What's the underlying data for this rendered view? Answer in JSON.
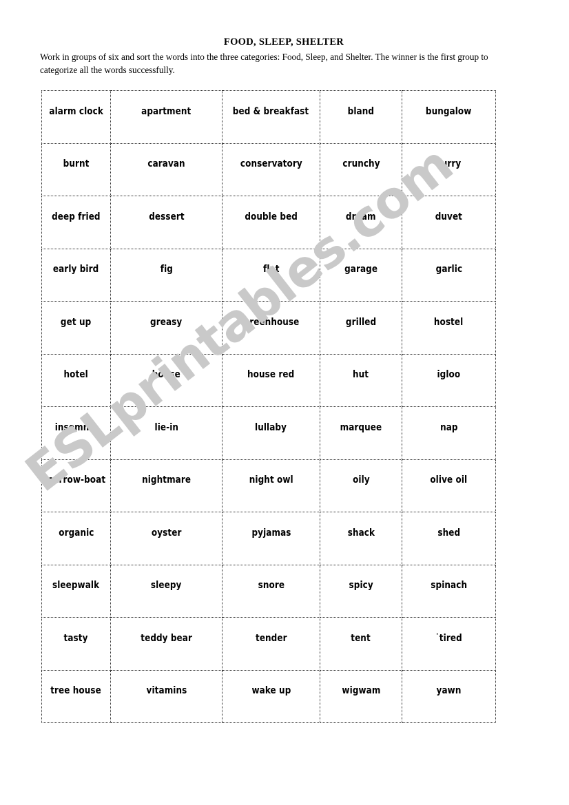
{
  "document": {
    "title": "FOOD, SLEEP, SHELTER",
    "instructions": "Work in groups of six and sort the words into the three categories: Food, Sleep, and Shelter. The winner is the first group to categorize all the words successfully.",
    "watermark": "ESLprintables.com",
    "watermark_color": "#c9c9c9",
    "text_color": "#000000",
    "background_color": "#ffffff",
    "border_color": "#2b2b2b",
    "border_style": "dotted"
  },
  "word_grid": {
    "columns": 5,
    "rows_count": 12,
    "rows": [
      [
        "alarm clock",
        "apartment",
        "bed & breakfast",
        "bland",
        "bungalow"
      ],
      [
        "burnt",
        "caravan",
        "conservatory",
        "crunchy",
        "curry"
      ],
      [
        "deep fried",
        "dessert",
        "double bed",
        "dream",
        "duvet"
      ],
      [
        "early bird",
        "fig",
        "flat",
        "garage",
        "garlic"
      ],
      [
        "get up",
        "greasy",
        "greenhouse",
        "grilled",
        "hostel"
      ],
      [
        "hotel",
        "house",
        "house red",
        "hut",
        "igloo"
      ],
      [
        "insomnia",
        "lie-in",
        "lullaby",
        "marquee",
        "nap"
      ],
      [
        "narrow-boat",
        "nightmare",
        "night owl",
        "oily",
        "olive oil"
      ],
      [
        "organic",
        "oyster",
        "pyjamas",
        "shack",
        "shed"
      ],
      [
        "sleepwalk",
        "sleepy",
        "snore",
        "spicy",
        "spinach"
      ],
      [
        "tasty",
        "teddy bear",
        "tender",
        "tent",
        "˙tired"
      ],
      [
        "tree house",
        "vitamins",
        "wake up",
        "wigwam",
        "yawn"
      ]
    ]
  }
}
